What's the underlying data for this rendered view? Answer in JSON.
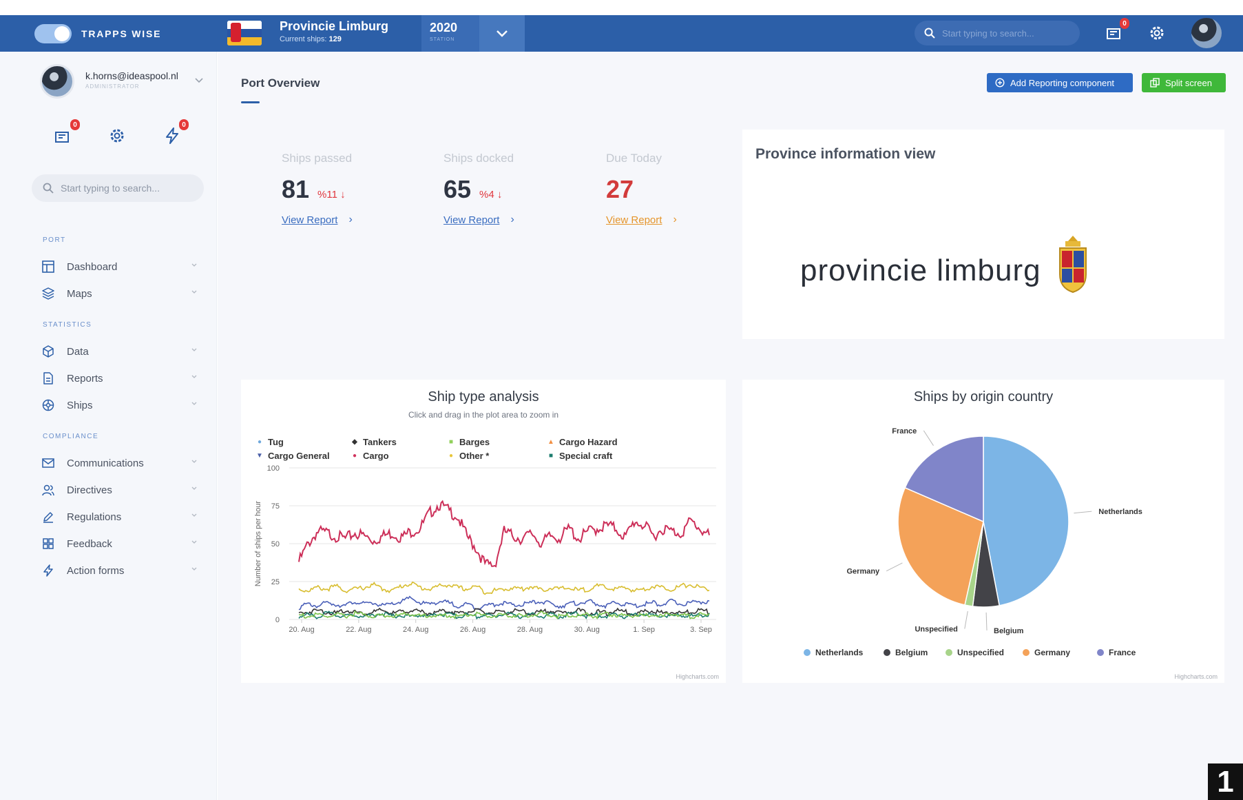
{
  "topbar": {
    "brand": "TRAPPS WISE",
    "province_name": "Provincie Limburg",
    "current_ships_label": "Current ships:",
    "current_ships_value": "129",
    "year": "2020",
    "year_sub": "STATION",
    "search_placeholder": "Start typing to search...",
    "notifications_badge": "0",
    "accent_color": "#2c5fa8"
  },
  "sidebar": {
    "user_email": "k.horns@ideaspool.nl",
    "user_role": "ADMINISTRATOR",
    "messages_badge": "0",
    "actions_badge": "0",
    "search_placeholder": "Start typing to search...",
    "sections": {
      "port": "PORT",
      "statistics": "STATISTICS",
      "compliance": "COMPLIANCE"
    },
    "items": [
      {
        "label": "Dashboard",
        "icon": "dashboard-icon"
      },
      {
        "label": "Maps",
        "icon": "layers-icon"
      },
      {
        "label": "Data",
        "icon": "cube-icon"
      },
      {
        "label": "Reports",
        "icon": "document-icon"
      },
      {
        "label": "Ships",
        "icon": "ship-wheel-icon"
      },
      {
        "label": "Communications",
        "icon": "mail-icon"
      },
      {
        "label": "Directives",
        "icon": "users-icon"
      },
      {
        "label": "Regulations",
        "icon": "pen-icon"
      },
      {
        "label": "Feedback",
        "icon": "grid-icon"
      },
      {
        "label": "Action forms",
        "icon": "bolt-icon"
      }
    ]
  },
  "main": {
    "page_title": "Port Overview",
    "add_reporting_label": "Add Reporting component",
    "split_screen_label": "Split screen",
    "stats": [
      {
        "label": "Ships passed",
        "value": "81",
        "delta": "%11 ↓",
        "link": "View Report"
      },
      {
        "label": "Ships docked",
        "value": "65",
        "delta": "%4 ↓",
        "link": "View Report"
      },
      {
        "label": "Due Today",
        "value": "27",
        "delta": "",
        "link": "View Report"
      }
    ],
    "province_card": {
      "title": "Province information view",
      "logo_text": "provincie limburg"
    },
    "line_chart": {
      "title": "Ship type analysis",
      "subtitle": "Click and drag in the plot area to zoom in",
      "credit": "Highcharts.com"
    },
    "pie_chart": {
      "title": "Ships by origin country",
      "credit": "Highcharts.com"
    }
  },
  "corner_label": "1",
  "chart_data": [
    {
      "type": "line",
      "title": "Ship type analysis",
      "ylabel": "Number of ships per hour",
      "ylim": [
        0,
        100
      ],
      "yticks": [
        0,
        25,
        50,
        75,
        100
      ],
      "x": [
        "20. Aug",
        "22. Aug",
        "24. Aug",
        "26. Aug",
        "28. Aug",
        "30. Aug",
        "1. Sep",
        "3. Sep"
      ],
      "legend": [
        {
          "name": "Tug",
          "color": "#6fa8dc",
          "marker": "●"
        },
        {
          "name": "Tankers",
          "color": "#333333",
          "marker": "◆"
        },
        {
          "name": "Barges",
          "color": "#90d05a",
          "marker": "■"
        },
        {
          "name": "Cargo Hazard",
          "color": "#f28f43",
          "marker": "▲"
        },
        {
          "name": "Cargo General",
          "color": "#4a5fa8",
          "marker": "▼"
        },
        {
          "name": "Cargo",
          "color": "#d0345e",
          "marker": "●"
        },
        {
          "name": "Other *",
          "color": "#e8c63a",
          "marker": "●"
        },
        {
          "name": "Special craft",
          "color": "#1c7d6e",
          "marker": "■"
        }
      ],
      "series": [
        {
          "name": "Cargo",
          "color": "#cc2e58",
          "values": [
            38,
            50,
            58,
            57,
            55,
            53,
            57,
            55,
            52,
            55,
            57,
            54,
            58,
            60,
            70,
            76,
            72,
            68,
            55,
            47,
            36,
            36,
            58,
            55,
            53,
            57,
            50,
            55,
            54,
            60,
            53,
            58,
            60,
            62,
            60,
            54,
            65,
            62,
            55,
            60,
            58,
            57,
            65,
            60,
            55
          ]
        },
        {
          "name": "Other *",
          "color": "#d8bd2f",
          "values": [
            20,
            19,
            21,
            20,
            22,
            19,
            20,
            21,
            23,
            20,
            19,
            22,
            24,
            21,
            20,
            22,
            23,
            21,
            20,
            22,
            18,
            19,
            20,
            21,
            20,
            22,
            19,
            21,
            20,
            21,
            19,
            20,
            22,
            21,
            20,
            21,
            19,
            20,
            22,
            21,
            20,
            22,
            23,
            21,
            20
          ]
        },
        {
          "name": "Cargo General",
          "color": "#4a5fb8",
          "values": [
            8,
            10,
            9,
            11,
            10,
            9,
            12,
            10,
            11,
            9,
            10,
            12,
            14,
            11,
            10,
            12,
            11,
            9,
            10,
            8,
            9,
            10,
            11,
            9,
            10,
            11,
            12,
            10,
            9,
            10,
            11,
            12,
            10,
            9,
            11,
            10,
            9,
            10,
            11,
            10,
            12,
            10,
            11,
            12,
            11
          ]
        },
        {
          "name": "Tankers",
          "color": "#333333",
          "values": [
            4,
            5,
            6,
            5,
            4,
            6,
            5,
            4,
            5,
            6,
            4,
            5,
            6,
            5,
            4,
            5,
            6,
            4,
            5,
            6,
            4,
            5,
            4,
            6,
            5,
            4,
            5,
            6,
            4,
            5,
            6,
            4,
            5,
            4,
            6,
            5,
            4,
            5,
            6,
            4,
            5,
            4,
            5,
            6,
            5
          ]
        },
        {
          "name": "Special craft",
          "color": "#1c7d6e",
          "values": [
            2,
            3,
            2,
            4,
            3,
            2,
            3,
            2,
            3,
            4,
            2,
            3,
            2,
            3,
            2,
            4,
            3,
            2,
            3,
            2,
            3,
            2,
            4,
            3,
            2,
            3,
            2,
            3,
            2,
            3,
            4,
            2,
            3,
            2,
            3,
            2,
            3,
            4,
            2,
            3,
            2,
            3,
            2,
            3,
            3
          ]
        },
        {
          "name": "Barges",
          "color": "#7cc24a",
          "values": [
            3,
            2,
            3,
            2,
            3,
            2,
            4,
            3,
            2,
            3,
            2,
            3,
            4,
            2,
            3,
            2,
            3,
            2,
            3,
            4,
            2,
            3,
            2,
            3,
            2,
            3,
            4,
            3,
            2,
            3,
            2,
            3,
            2,
            4,
            3,
            2,
            3,
            2,
            3,
            2,
            4,
            3,
            2,
            3,
            2
          ]
        }
      ]
    },
    {
      "type": "pie",
      "title": "Ships by origin country",
      "series": [
        {
          "name": "Netherlands",
          "value": 47,
          "color": "#7cb5e6"
        },
        {
          "name": "Belgium",
          "value": 5,
          "color": "#434348"
        },
        {
          "name": "Unspecified",
          "value": 1.5,
          "color": "#a8d48a"
        },
        {
          "name": "Germany",
          "value": 28,
          "color": "#f4a259"
        },
        {
          "name": "France",
          "value": 18.5,
          "color": "#8085c9"
        }
      ],
      "legend_position": "bottom"
    }
  ]
}
